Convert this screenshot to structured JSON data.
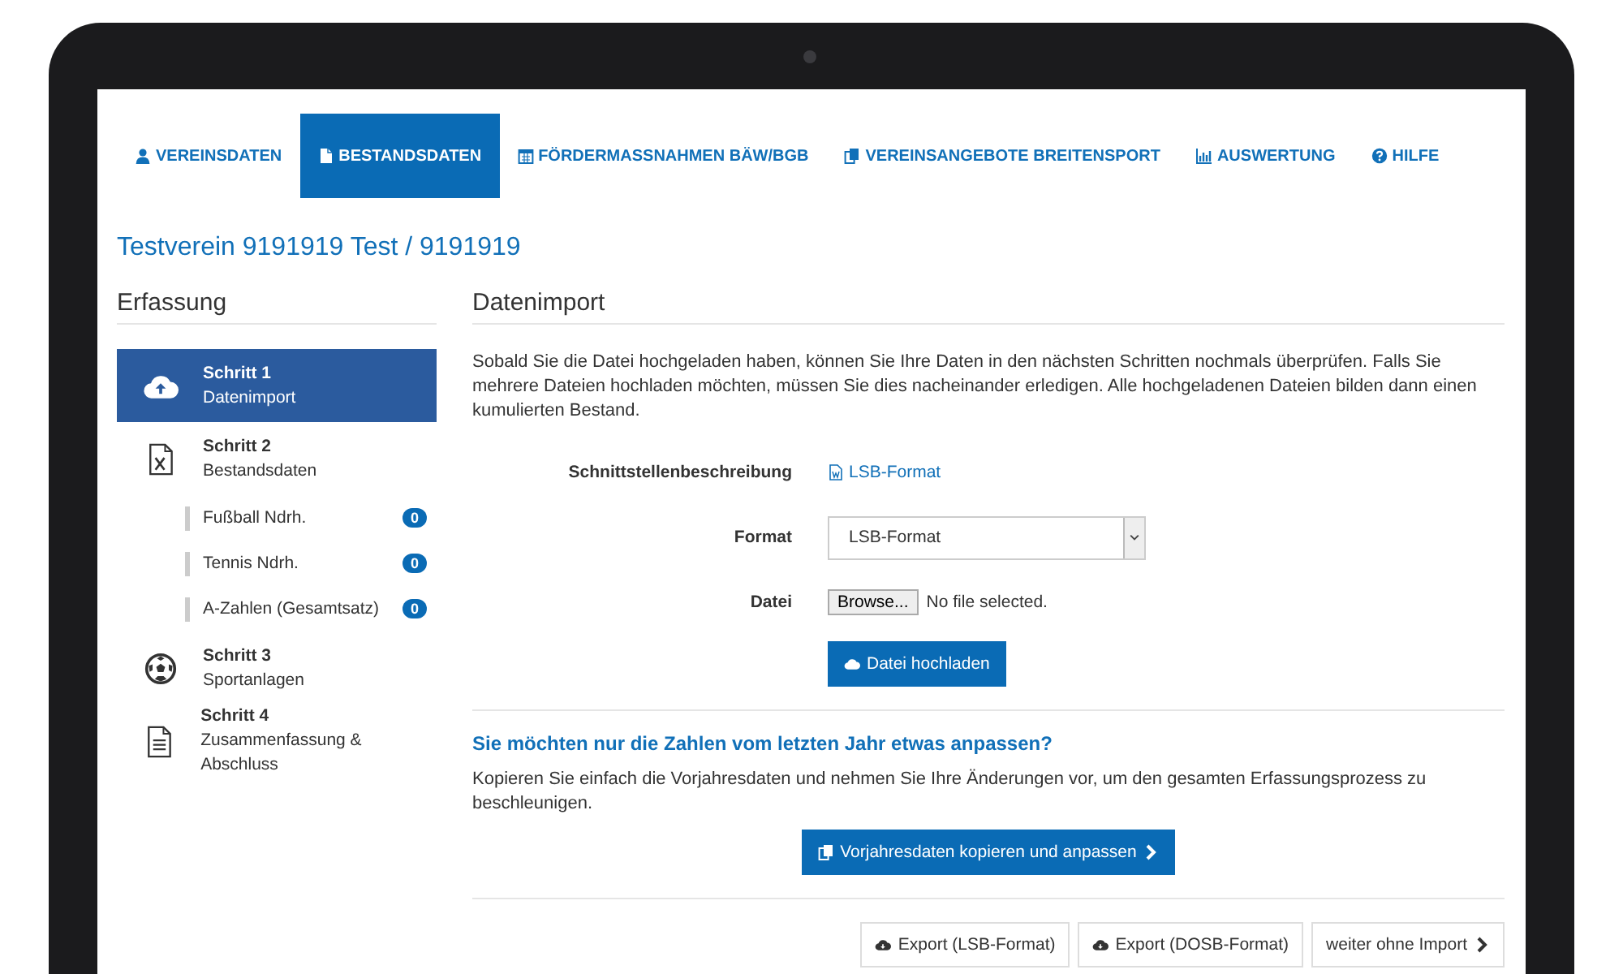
{
  "tabs": [
    {
      "label": "VEREINSDATEN",
      "selected": false
    },
    {
      "label": "BESTANDSDATEN",
      "selected": true
    },
    {
      "label": "FÖRDERMASSNAHMEN BÄW/BGB",
      "selected": false
    },
    {
      "label": "VEREINSANGEBOTE BREITENSPORT",
      "selected": false
    },
    {
      "label": "AUSWERTUNG",
      "selected": false
    },
    {
      "label": "HILFE",
      "selected": false
    }
  ],
  "page_title": "Testverein 9191919 Test / 9191919",
  "sidebar": {
    "heading": "Erfassung",
    "steps": [
      {
        "title": "Schritt 1",
        "subtitle": "Datenimport",
        "selected": true
      },
      {
        "title": "Schritt 2",
        "subtitle": "Bestandsdaten",
        "selected": false,
        "children": [
          {
            "label": "Fußball Ndrh.",
            "count": "0"
          },
          {
            "label": "Tennis Ndrh.",
            "count": "0"
          },
          {
            "label": "A-Zahlen (Gesamtsatz)",
            "count": "0"
          }
        ]
      },
      {
        "title": "Schritt 3",
        "subtitle": "Sportanlagen",
        "selected": false
      },
      {
        "title": "Schritt 4",
        "subtitle": "Zusammenfassung & Abschluss",
        "selected": false
      }
    ]
  },
  "main": {
    "heading": "Datenimport",
    "intro": "Sobald Sie die Datei hochgeladen haben, können Sie Ihre Daten in den nächsten Schritten nochmals überprüfen. Falls Sie mehrere Dateien hochladen möchten, müssen Sie dies nacheinander erledigen. Alle hochgeladenen Dateien bilden dann einen kumulierten Bestand.",
    "form": [
      {
        "label": "Schnittstellenbeschreibung",
        "kind": "link",
        "value": "LSB-Format"
      },
      {
        "label": "Format",
        "kind": "select",
        "value": "LSB-Format"
      },
      {
        "label": "Datei",
        "kind": "file",
        "button": "Browse...",
        "value": "No file selected."
      }
    ],
    "upload_button": "Datei hochladen",
    "copy_section": {
      "heading": "Sie möchten nur die Zahlen vom letzten Jahr etwas anpassen?",
      "text": "Kopieren Sie einfach die Vorjahresdaten und nehmen Sie Ihre Änderungen vor, um den gesamten Erfassungsprozess zu beschleunigen.",
      "button": "Vorjahresdaten kopieren und anpassen"
    },
    "footer_buttons": [
      {
        "label": "Export (LSB-Format)"
      },
      {
        "label": "Export (DOSB-Format)"
      },
      {
        "label": "weiter ohne Import"
      }
    ]
  }
}
